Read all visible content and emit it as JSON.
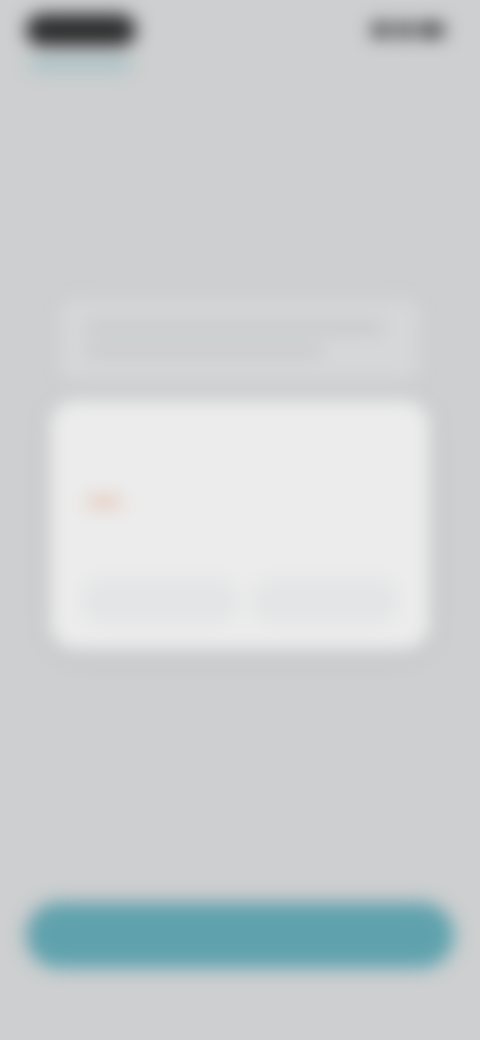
{
  "status_bar": {
    "time": "",
    "icons": [
      "signal-icon",
      "wifi-icon",
      "battery-icon"
    ]
  },
  "heading": {
    "line1": "",
    "line2": ""
  },
  "dialog": {
    "title": "",
    "body": "",
    "buttons": {
      "secondary": "",
      "primary": ""
    }
  },
  "footnote": "",
  "small_link": "",
  "primary_button": {
    "label": ""
  },
  "colors": {
    "accent": "#5fa2ad",
    "background": "#cdcfd0",
    "dialog": "#ececec",
    "warning": "#e4c3b1"
  }
}
